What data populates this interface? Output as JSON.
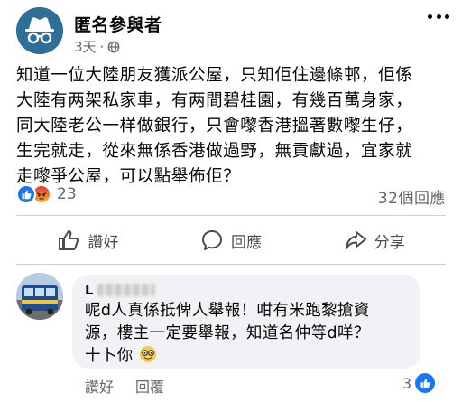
{
  "post": {
    "author": "匿名參與者",
    "time": "3天",
    "visibility_icon": "globe-icon",
    "lines": [
      "知道一位大陸朋友獲派公屋，只知佢住邊條邨，佢係",
      "大陸有两架私家車，有两間碧桂園，有幾百萬身家，",
      "同大陸老公一样做銀行，只會嚟香港搵著數嚟生仔，",
      "生完就走，從來無係香港做過野，無貢獻過，宜家就",
      "走嚟爭公屋，可以點舉佈佢？"
    ],
    "reaction_count": "23",
    "comment_count": "32個回應"
  },
  "actions": {
    "like_label": "讚好",
    "comment_label": "回應",
    "share_label": "分享"
  },
  "comment": {
    "author_initial": "L",
    "lines": [
      "呢d人真係抵俾人舉報！咁有米跑黎搶資",
      "源，樓主一定要舉報，知道名仲等d咩？",
      "十卜你"
    ],
    "like_label": "讚好",
    "reply_label": "回覆",
    "reaction_count": "3"
  },
  "colors": {
    "accent": "#1877f2",
    "muted": "#65676b",
    "bubble": "#f0f2f5"
  }
}
